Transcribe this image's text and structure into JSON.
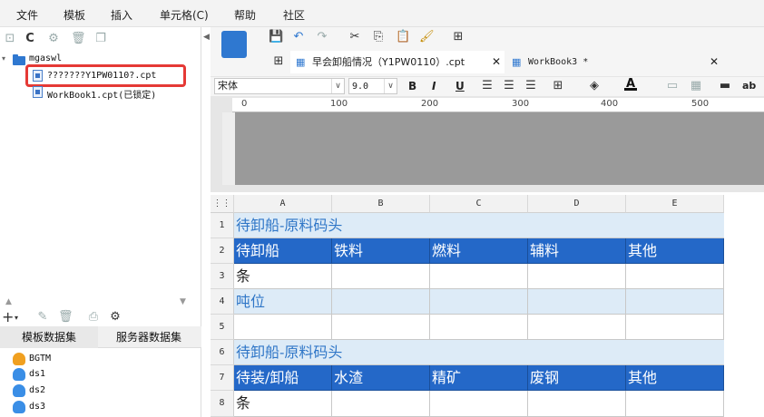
{
  "menubar": {
    "items": [
      "文件",
      "模板",
      "插入",
      "单元格(C)",
      "帮助",
      "社区"
    ]
  },
  "left_panel": {
    "tree": {
      "folder": "mgaswl",
      "file1": "???????Y1PW0110?.cpt",
      "file2": "WorkBook1.cpt(已锁定)"
    },
    "tabs": {
      "template_ds": "模板数据集",
      "server_ds": "服务器数据集"
    },
    "datasets": [
      "BGTM",
      "ds1",
      "ds2",
      "ds3"
    ]
  },
  "doc_tabs": {
    "tab1": "早会卸船情况（Y1PW0110）.cpt",
    "tab2": "WorkBook3 *"
  },
  "format_bar": {
    "font": "宋体",
    "size": "9.0",
    "bold": "B",
    "italic": "I",
    "underline": "U",
    "ab": "ab"
  },
  "ruler": {
    "marks": [
      "0",
      "100",
      "200",
      "300",
      "400",
      "500"
    ]
  },
  "grid": {
    "columns": [
      "A",
      "B",
      "C",
      "D",
      "E"
    ],
    "rows": [
      "1",
      "2",
      "3",
      "4",
      "5",
      "6",
      "7",
      "8"
    ],
    "r1": "待卸船-原料码头",
    "r2": [
      "待卸船",
      "铁料",
      "燃料",
      "辅料",
      "其他"
    ],
    "r3": "条",
    "r4": "吨位",
    "r6": "待卸船-原料码头",
    "r7": [
      "待装/卸船",
      "水渣",
      "精矿",
      "废钢",
      "其他"
    ],
    "r8": "条"
  },
  "colors": {
    "header_blue": "#2468c8",
    "title_bg": "#ddebf7",
    "title_text": "#2f76c7",
    "highlight": "#e53935"
  }
}
